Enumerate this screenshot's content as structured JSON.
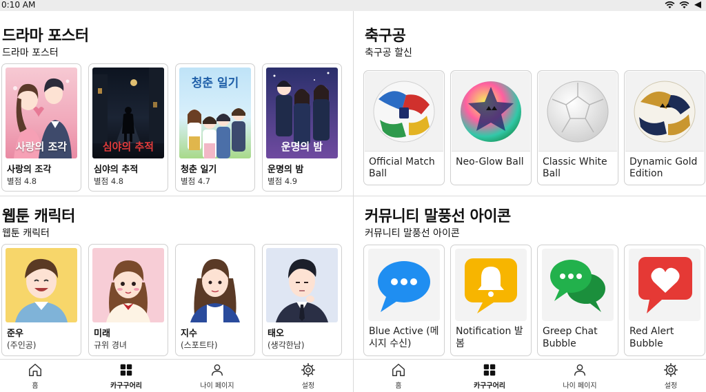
{
  "status_bar": {
    "time": "0:10 AM"
  },
  "left_pane": {
    "drama": {
      "title": "드라마 포스터",
      "subtitle": "드라마 포스터",
      "items": [
        {
          "poster_text": "사랑의 조각",
          "name": "사랑의 조각",
          "rating": "별점 4.8"
        },
        {
          "poster_text": "심야의 추적",
          "name": "심야의 추적",
          "rating": "별점 4.8"
        },
        {
          "poster_text": "청춘 일기",
          "name": "청춘 일기",
          "rating": "별점 4.7"
        },
        {
          "poster_text": "운명의 밤",
          "name": "운명의 밤",
          "rating": "별점 4.9"
        }
      ]
    },
    "webtoon": {
      "title": "웹툰 캐릭터",
      "subtitle": "웹툰 캐릭터",
      "items": [
        {
          "name": "준우",
          "desc": "(주인공)"
        },
        {
          "name": "미래",
          "desc": "규위 경녀"
        },
        {
          "name": "지수",
          "desc": "(스포트타)"
        },
        {
          "name": "태오",
          "desc": "(생각한남)"
        }
      ]
    },
    "nav": [
      {
        "label": "홈",
        "icon": "home-icon"
      },
      {
        "label": "카구구어리",
        "icon": "grid-icon"
      },
      {
        "label": "나이 페이지",
        "icon": "person-icon"
      },
      {
        "label": "설정",
        "icon": "gear-icon"
      }
    ]
  },
  "right_pane": {
    "soccer": {
      "title": "축구공",
      "subtitle": "축구공 할신",
      "items": [
        {
          "label": "Official Match Ball"
        },
        {
          "label": "Neo-Glow Ball"
        },
        {
          "label": "Classic White Ball"
        },
        {
          "label": "Dynamic Gold Edition"
        }
      ]
    },
    "bubbles": {
      "title": "커뮤니티 말풍선 아이콘",
      "subtitle": "커뮤니티 말풍선 아이콘",
      "items": [
        {
          "label": "Blue Active (메시지 수신)",
          "color": "#1f8ef1"
        },
        {
          "label": "Notification 발봄",
          "color": "#f7b500"
        },
        {
          "label": "Greep Chat Bubble",
          "color": "#22b14c"
        },
        {
          "label": "Red Alert Bubble",
          "color": "#e53935"
        }
      ]
    },
    "nav": [
      {
        "label": "홈",
        "icon": "home-icon"
      },
      {
        "label": "카구구어리",
        "icon": "grid-icon"
      },
      {
        "label": "나이 페이지",
        "icon": "person-icon"
      },
      {
        "label": "설정",
        "icon": "gear-icon"
      }
    ]
  }
}
